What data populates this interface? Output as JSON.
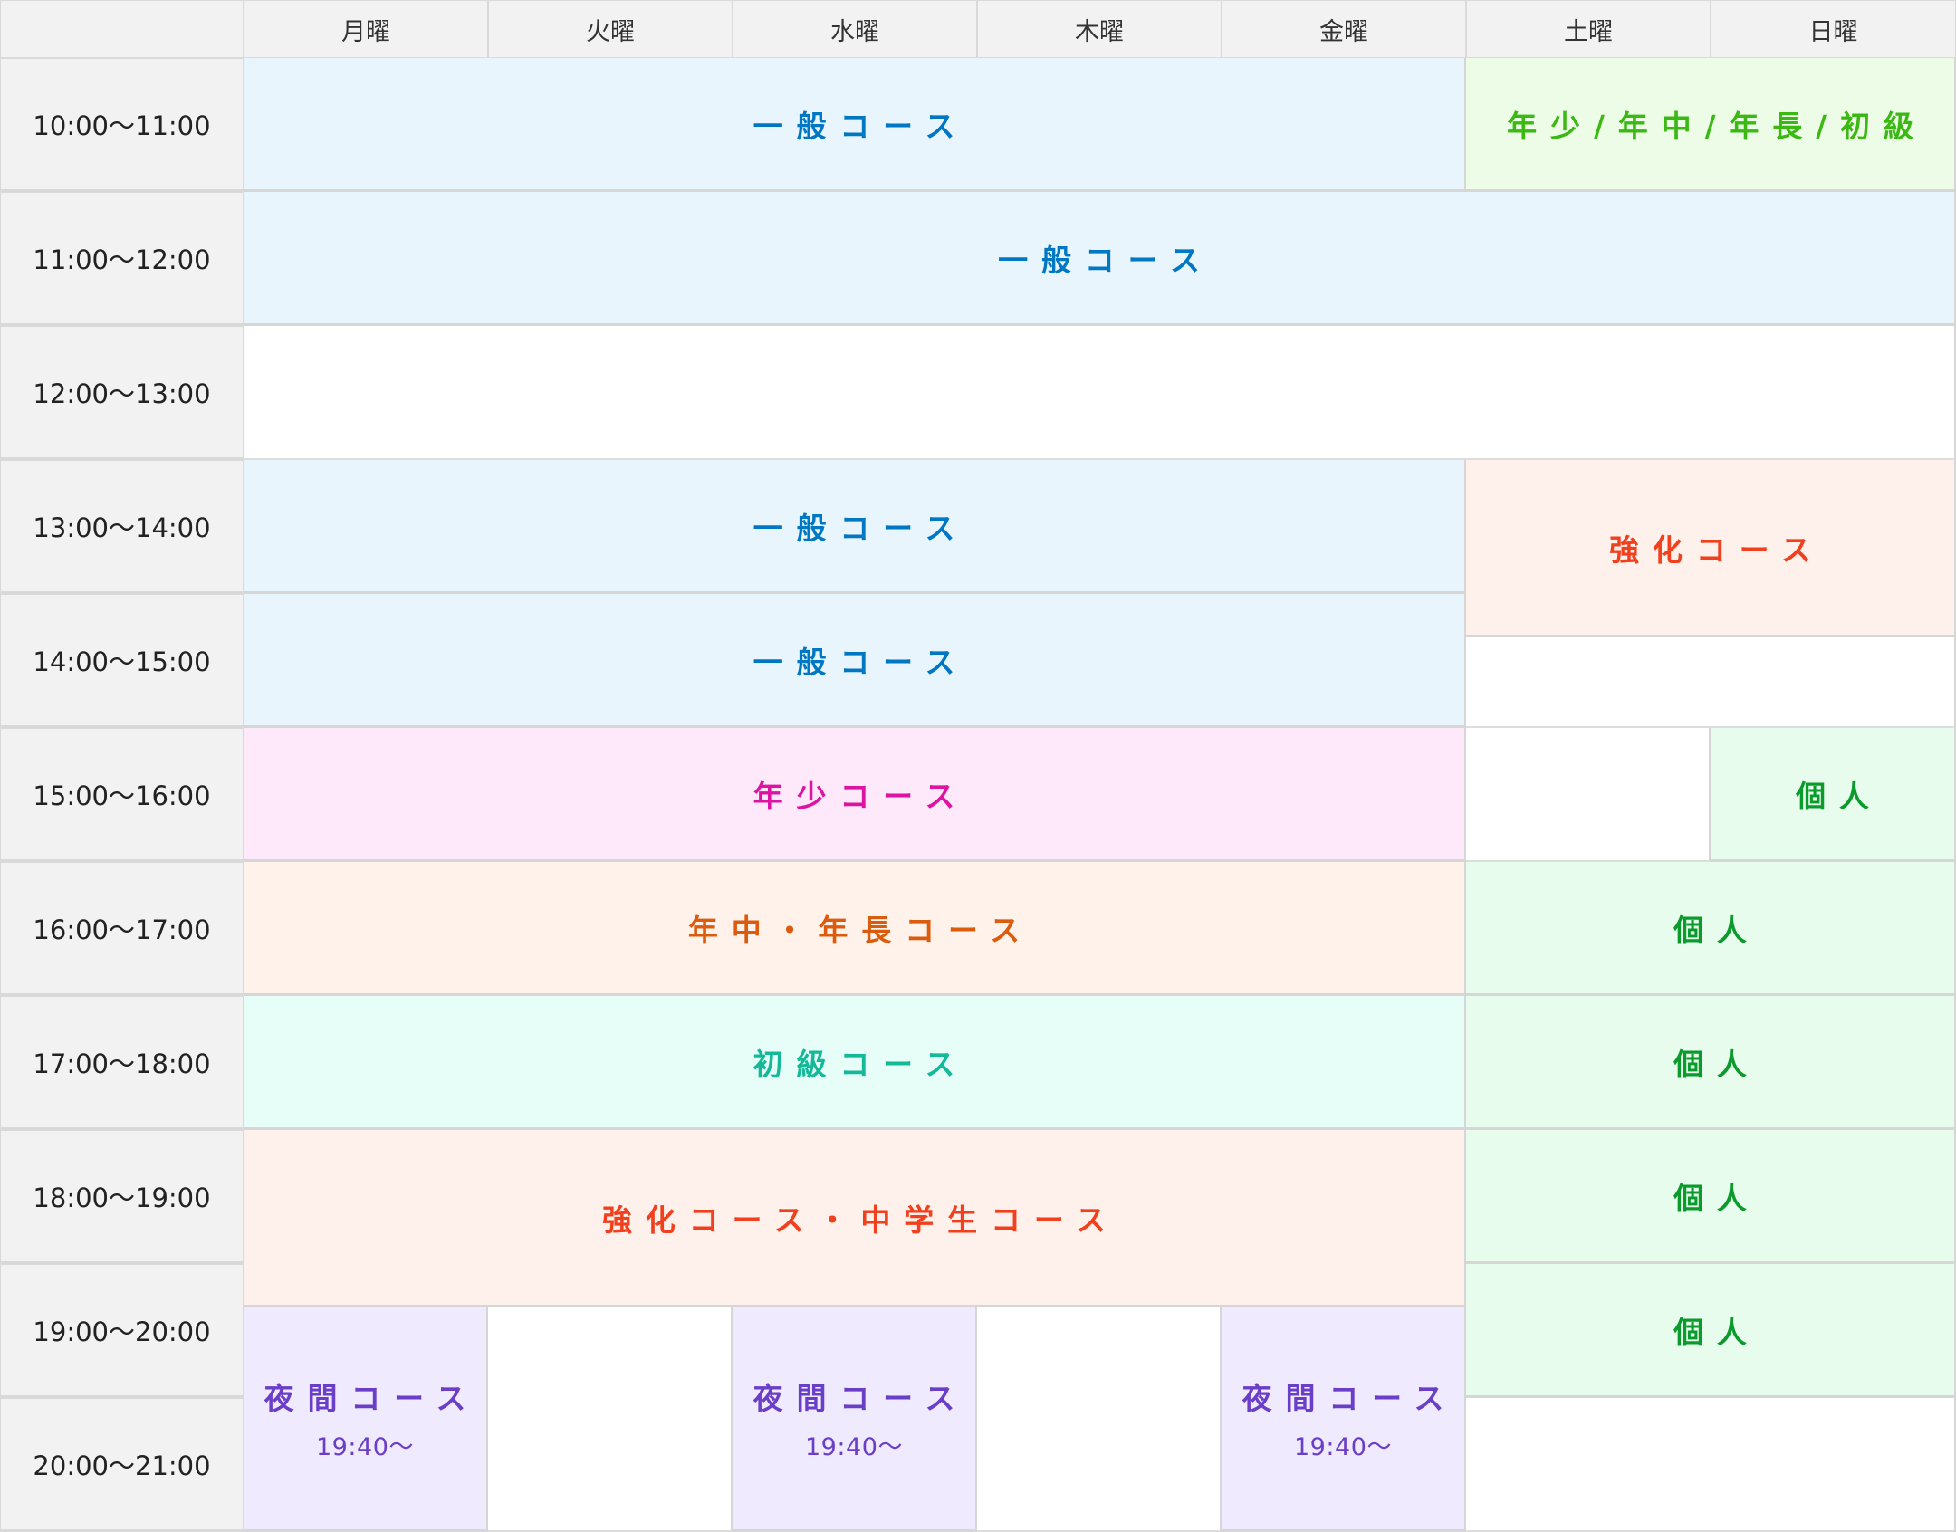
{
  "colors": {
    "blue_bg": "#e8f5fc",
    "blue_fg": "#0077c2",
    "lime_bg": "#edfce6",
    "lime_fg": "#3cb815",
    "salmon_bg": "#fef0ea",
    "salmon_fg": "#f0401e",
    "pink_bg": "#fde9f9",
    "pink_fg": "#dc13a3",
    "peach_bg": "#fff2eb",
    "peach_fg": "#dc5c0e",
    "mint_bg": "#e7fef8",
    "mint_fg": "#14b998",
    "green_bg": "#e8fced",
    "green_fg": "#0b9b2d",
    "purple_bg": "#efeafd",
    "purple_fg": "#6a3ec6"
  },
  "header": {
    "corner": "",
    "days": [
      "月曜",
      "火曜",
      "水曜",
      "木曜",
      "金曜",
      "土曜",
      "日曜"
    ]
  },
  "times": [
    "10:00〜11:00",
    "11:00〜12:00",
    "12:00〜13:00",
    "13:00〜14:00",
    "14:00〜15:00",
    "15:00〜16:00",
    "16:00〜17:00",
    "17:00〜18:00",
    "18:00〜19:00",
    "19:00〜20:00",
    "20:00〜21:00"
  ],
  "courses": [
    {
      "label": "一般コース",
      "sub": "",
      "color": "blue"
    },
    {
      "label": "年少/年中/年長/初級",
      "sub": "",
      "color": "lime"
    },
    {
      "label": "一般コース",
      "sub": "",
      "color": "blue"
    },
    {
      "label": "一般コース",
      "sub": "",
      "color": "blue"
    },
    {
      "label": "強化コース",
      "sub": "",
      "color": "salmon"
    },
    {
      "label": "一般コース",
      "sub": "",
      "color": "blue"
    },
    {
      "label": "年少コース",
      "sub": "",
      "color": "pink"
    },
    {
      "label": "個人",
      "sub": "",
      "color": "green"
    },
    {
      "label": "年中・年長コース",
      "sub": "",
      "color": "peach"
    },
    {
      "label": "個人",
      "sub": "",
      "color": "green"
    },
    {
      "label": "初級コース",
      "sub": "",
      "color": "mint"
    },
    {
      "label": "個人",
      "sub": "",
      "color": "green"
    },
    {
      "label": "強化コース・中学生コース",
      "sub": "",
      "color": "salmon"
    },
    {
      "label": "個人",
      "sub": "",
      "color": "green"
    },
    {
      "label": "個人",
      "sub": "",
      "color": "green"
    },
    {
      "label": "夜間コース",
      "sub": "19:40〜",
      "color": "purple"
    },
    {
      "label": "夜間コース",
      "sub": "19:40〜",
      "color": "purple"
    },
    {
      "label": "夜間コース",
      "sub": "19:40〜",
      "color": "purple"
    }
  ]
}
